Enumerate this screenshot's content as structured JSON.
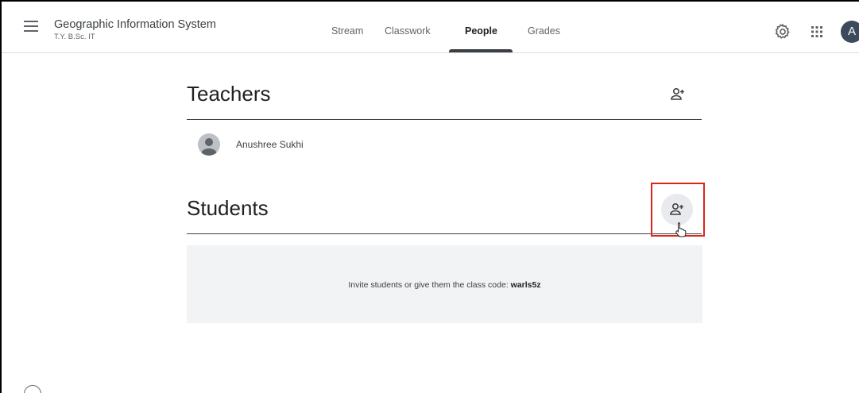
{
  "header": {
    "menu_icon": "hamburger-menu-icon",
    "class_title": "Geographic Information System",
    "class_subtitle": "T.Y. B.Sc. IT",
    "tabs": [
      {
        "label": "Stream",
        "active": false
      },
      {
        "label": "Classwork",
        "active": false
      },
      {
        "label": "People",
        "active": true
      },
      {
        "label": "Grades",
        "active": false
      }
    ],
    "settings_icon": "gear-icon",
    "apps_icon": "apps-grid-icon",
    "account_initial": "A"
  },
  "teachers": {
    "title": "Teachers",
    "add_icon": "add-person-icon",
    "list": [
      {
        "name": "Anushree Sukhi"
      }
    ]
  },
  "students": {
    "title": "Students",
    "add_icon": "add-person-icon",
    "invite_text": "Invite students or give them the class code: ",
    "class_code": "warls5z"
  },
  "colors": {
    "highlight": "#d9261c",
    "panel_bg": "#f1f3f4",
    "active_tab": "#3c4043"
  }
}
